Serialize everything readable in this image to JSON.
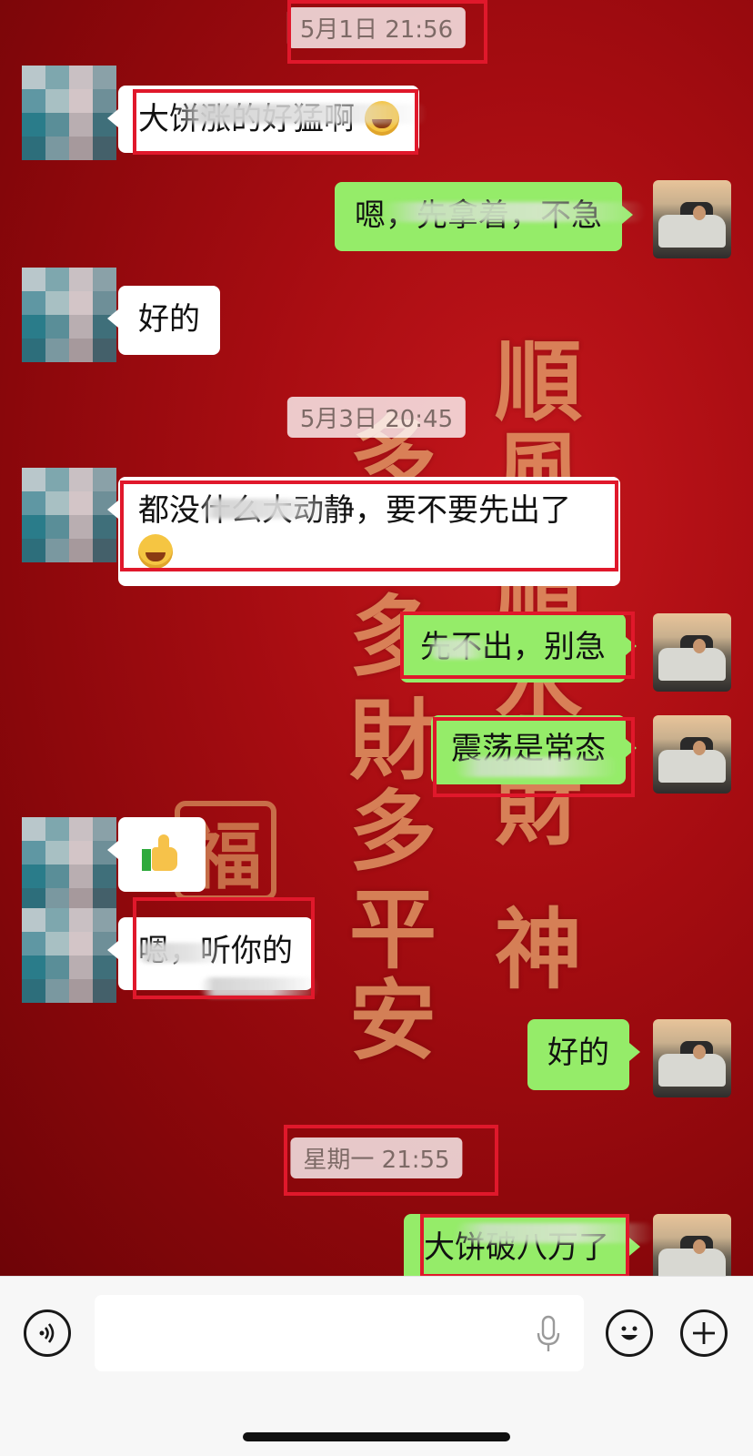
{
  "wallpaper": {
    "glyphs": [
      "順",
      "風",
      "順",
      "水",
      "財",
      "神",
      "多",
      "多",
      "財",
      "多",
      "平",
      "安"
    ],
    "seal": "福"
  },
  "timestamps": [
    "5月1日 21:56",
    "5月3日 20:45",
    "星期一 21:55"
  ],
  "messages": [
    {
      "side": "left",
      "text": "大饼涨的好猛啊",
      "emoji": "grinning-face"
    },
    {
      "side": "right",
      "text": "嗯，先拿着，不急"
    },
    {
      "side": "left",
      "text": "好的"
    },
    {
      "side": "left",
      "text": "都没什么大动静，要不要先出了",
      "emoji": "tears-of-joy-face"
    },
    {
      "side": "right",
      "text": "先不出，别急"
    },
    {
      "side": "right",
      "text": "震荡是常态"
    },
    {
      "side": "left",
      "emoji": "thumbs-up"
    },
    {
      "side": "left",
      "text": "嗯，听你的"
    },
    {
      "side": "right",
      "text": "好的"
    },
    {
      "side": "right",
      "text": "大饼破八万了"
    }
  ],
  "input_bar": {
    "voice_icon": "voice-toggle-icon",
    "mic_icon": "microphone-icon",
    "emoji_icon": "emoji-icon",
    "plus_icon": "plus-icon",
    "input_value": ""
  },
  "colors": {
    "right_bubble": "#95ec69",
    "left_bubble": "#ffffff",
    "highlight_box": "#e0182b",
    "wallpaper_red": "#a90d12"
  }
}
